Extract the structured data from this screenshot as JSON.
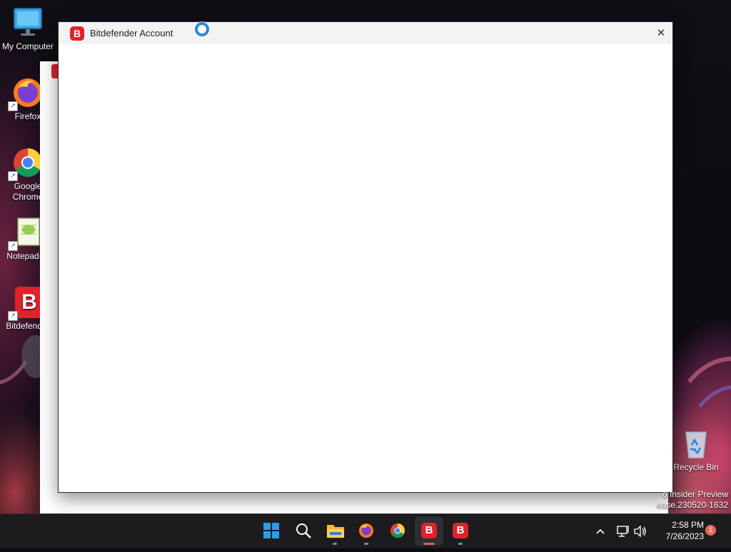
{
  "desktop": {
    "icons": [
      {
        "label": "My Computer",
        "icon": "monitor-icon"
      },
      {
        "label": "Firefox",
        "icon": "firefox-icon"
      },
      {
        "label": "Google Chrome",
        "icon": "chrome-icon"
      },
      {
        "label": "Notepad++",
        "icon": "notepad-plus-plus-icon"
      },
      {
        "label": "Bitdefender",
        "icon": "bitdefender-icon"
      },
      {
        "label": "Recycle Bin",
        "icon": "recycle-bin-icon"
      }
    ],
    "watermark": {
      "line1": "o Insider Preview",
      "line2": "ease.230520-1632"
    }
  },
  "window": {
    "title": "Bitdefender Account",
    "logo_letter": "B",
    "close_symbol": "✕"
  },
  "taskbar": {
    "apps": [
      {
        "name": "start",
        "icon": "windows-start-icon"
      },
      {
        "name": "search",
        "icon": "search-icon"
      },
      {
        "name": "file-explorer",
        "icon": "folder-icon"
      },
      {
        "name": "firefox",
        "icon": "firefox-icon"
      },
      {
        "name": "chrome",
        "icon": "chrome-icon"
      },
      {
        "name": "bitdefender",
        "icon": "bitdefender-icon",
        "letter": "B"
      },
      {
        "name": "bitdefender-2",
        "icon": "bitdefender-icon",
        "letter": "B"
      }
    ],
    "clock": {
      "time": "2:58 PM",
      "date": "7/26/2023"
    },
    "notification_count": "1"
  },
  "colors": {
    "bitdefender_red": "#e2222b",
    "taskbar_bg": "#1c1c1f"
  }
}
